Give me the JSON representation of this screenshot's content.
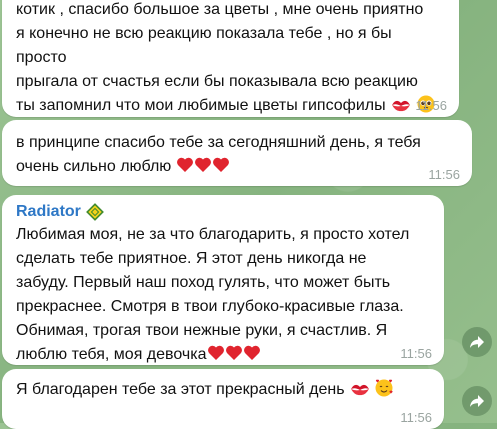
{
  "messages": [
    {
      "text": "котик , спасибо большое за цветы , мне очень приятно\nя конечно не всю реакцию показала тебе , но я бы просто\nпрыгала от счастья если бы показывала всю реакцию\nты запомнил что мои любимые цветы гипсофилы",
      "time": "11:56",
      "emojis": [
        "kiss-mark-icon",
        "pleading-face-icon"
      ]
    },
    {
      "text": "в принципе спасибо тебе за сегодняшний день, я тебя\nочень сильно люблю",
      "time": "11:56",
      "emojis": [
        "red-heart-icon",
        "red-heart-icon",
        "red-heart-icon"
      ]
    },
    {
      "author": "Radiator",
      "author_color": "#2e78c6",
      "text": "Любимая моя, не за что благодарить, я просто хотел\nсделать тебе приятное. Я этот день никогда не\nзабуду. Первый наш поход гулять, что может быть\nпрекраснее. Смотря в твои глубоко-красивые глаза.\nОбнимая, трогая твои нежные руки, я счастлив. Я\nлюблю тебя, моя девочка",
      "time": "11:56",
      "emojis": [
        "red-heart-icon",
        "red-heart-icon",
        "red-heart-icon"
      ]
    },
    {
      "text": "Я благодарен тебе за этот прекрасный день",
      "time": "11:56",
      "emojis": [
        "kiss-mark-icon",
        "smiling-face-with-hearts-icon"
      ]
    }
  ],
  "colors": {
    "bubble": "#ffffff",
    "time": "#9aa4a0",
    "heart": "#e0242e",
    "background": "#8fb989"
  },
  "icons": {
    "author_badge": "yellow-diamond-badge-icon",
    "share": "share-arrow-icon"
  }
}
